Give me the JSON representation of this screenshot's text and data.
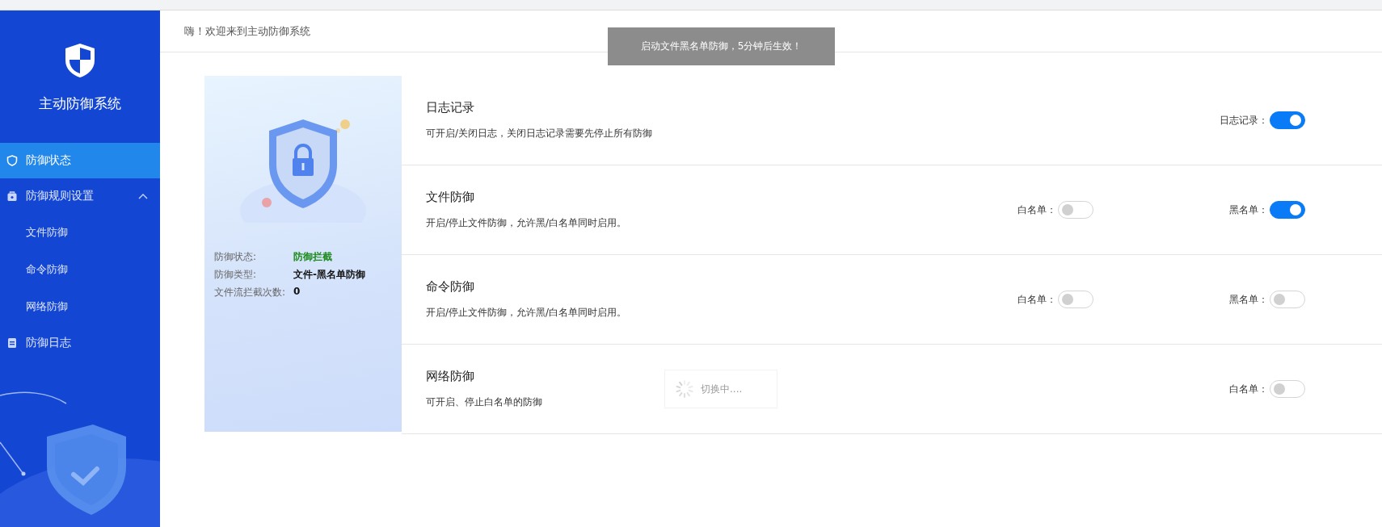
{
  "sidebar": {
    "title": "主动防御系统",
    "items": [
      {
        "kind": "item",
        "label": "防御状态",
        "selected": true
      },
      {
        "kind": "group",
        "label": "防御规则设置",
        "expanded": true,
        "selected": false,
        "children": [
          {
            "label": "文件防御",
            "selected": false
          },
          {
            "label": "命令防御",
            "selected": false
          },
          {
            "label": "网络防御",
            "selected": false
          }
        ]
      },
      {
        "kind": "item",
        "label": "防御日志",
        "selected": false
      }
    ]
  },
  "header": {
    "greeting": "嗨！欢迎来到主动防御系统"
  },
  "toast": {
    "text": "启动文件黑名单防御，5分钟后生效！"
  },
  "status_card": {
    "fields": [
      {
        "label": "防御状态:",
        "value": "防御拦截",
        "kind": "status"
      },
      {
        "label": "防御类型:",
        "value": "文件-黑名单防御",
        "kind": "plain"
      },
      {
        "label": "文件流拦截次数:",
        "value": "0",
        "kind": "plain"
      }
    ]
  },
  "sections": [
    {
      "title": "日志记录",
      "description": "可开启/关闭日志，关闭日志记录需要先停止所有防御",
      "switches": [
        {
          "label": "日志记录：",
          "on": true
        }
      ]
    },
    {
      "title": "文件防御",
      "description": "开启/停止文件防御，允许黑/白名单同时启用。",
      "switches": [
        {
          "label": "白名单：",
          "on": false
        },
        {
          "label": "黑名单：",
          "on": true
        }
      ]
    },
    {
      "title": "命令防御",
      "description": "开启/停止文件防御，允许黑/白名单同时启用。",
      "switches": [
        {
          "label": "白名单：",
          "on": false
        },
        {
          "label": "黑名单：",
          "on": false
        }
      ]
    },
    {
      "title": "网络防御",
      "description": "可开启、停止白名单的防御",
      "switches": [
        {
          "label": "白名单：",
          "on": false
        }
      ]
    }
  ],
  "loading": {
    "text": "切换中...."
  }
}
